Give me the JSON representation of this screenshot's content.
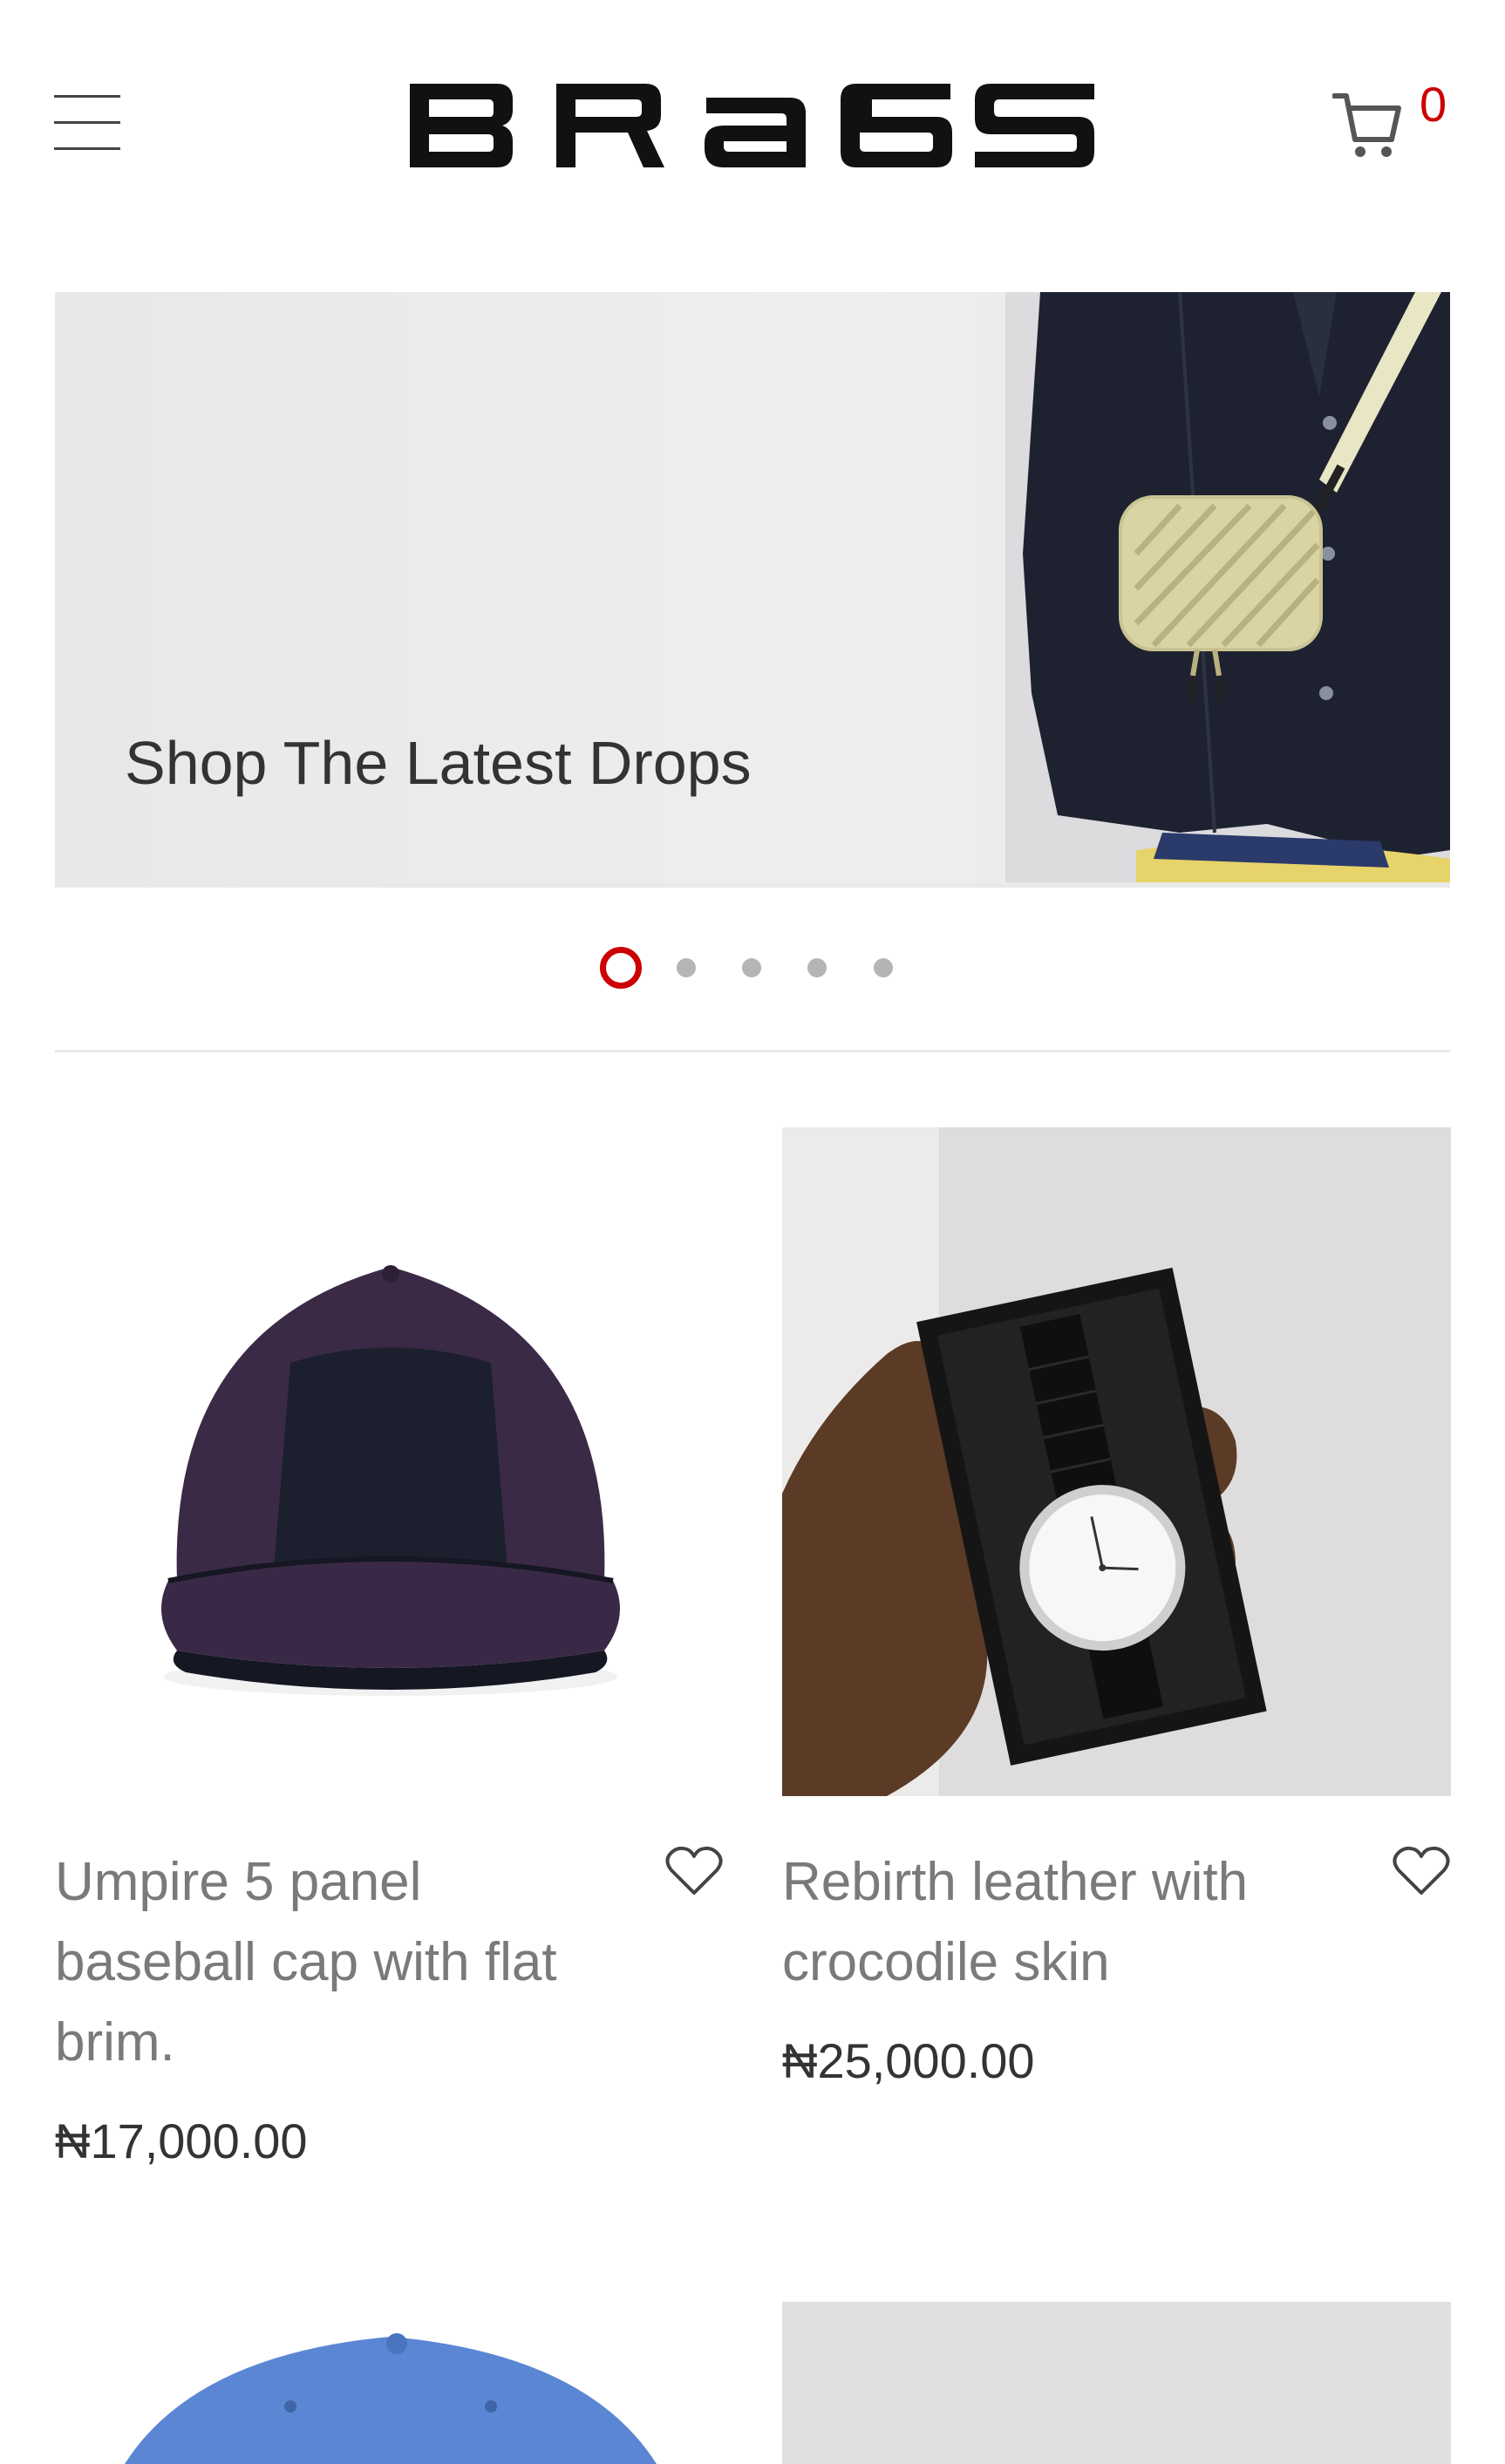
{
  "header": {
    "logo_text": "BRAGS",
    "cart_count": "0",
    "menu_icon": "hamburger-menu-icon",
    "cart_icon": "shopping-cart-icon"
  },
  "hero": {
    "title": "Shop The Latest Drops",
    "slide_count": 5,
    "active_slide": 1
  },
  "products": [
    {
      "name": "Umpire 5 panel baseball cap with flat brim.",
      "price": "₦17,000.00"
    },
    {
      "name": "Rebirth leather with crocodile skin",
      "price": "₦25,000.00"
    }
  ],
  "colors": {
    "accent": "#cc0000",
    "text_muted": "#7a7a7a",
    "price": "#333333"
  }
}
